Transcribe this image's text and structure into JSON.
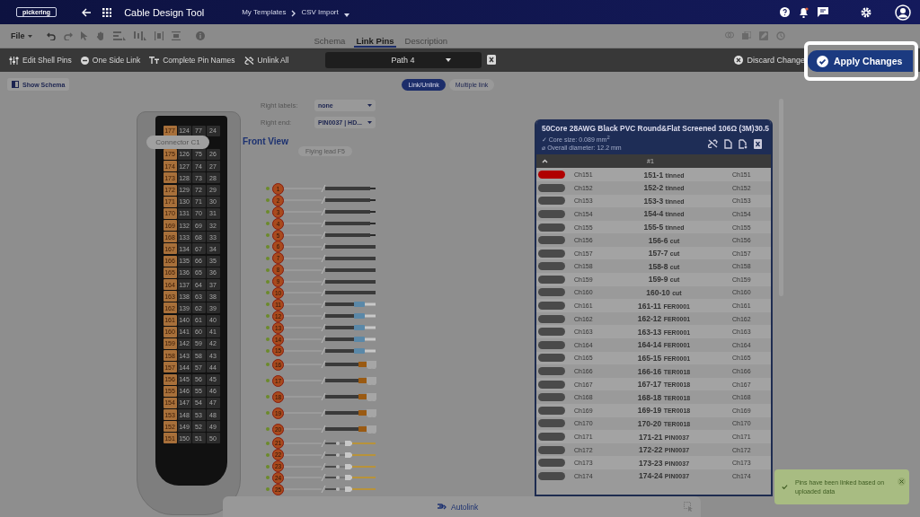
{
  "header": {
    "logo": "pickering",
    "app_title": "Cable Design Tool",
    "breadcrumb": [
      "My Templates",
      "CSV Import"
    ]
  },
  "menu": {
    "file": "File"
  },
  "view_tabs": [
    {
      "label": "Schema",
      "selected": false
    },
    {
      "label": "Link Pins",
      "selected": true
    },
    {
      "label": "Description",
      "selected": false
    }
  ],
  "actions": [
    {
      "label": "Edit Shell Pins",
      "kind": "shell"
    },
    {
      "label": "One Side Link",
      "kind": "one-side"
    },
    {
      "label": "Complete Pin Names",
      "kind": "text"
    },
    {
      "label": "Unlink All",
      "kind": "unlink"
    }
  ],
  "path_select": {
    "value": "Path 4"
  },
  "discard": "Discard Change",
  "apply": "Apply Changes",
  "show_schema": "Show Schema",
  "link_modes": [
    {
      "label": "Link/Unlink",
      "selected": true
    },
    {
      "label": "Multiple link",
      "selected": false
    }
  ],
  "selectors": [
    {
      "label": "Right labels:",
      "value": "none"
    },
    {
      "label": "Right end:",
      "value": "PIN0037 | HD..."
    }
  ],
  "connector": {
    "label": "Connector C1",
    "pin_rows": [
      [
        "177",
        "124",
        "77",
        "24"
      ],
      [
        "175",
        "126",
        "75",
        "26"
      ],
      [
        "174",
        "127",
        "74",
        "27"
      ],
      [
        "173",
        "128",
        "73",
        "28"
      ],
      [
        "172",
        "129",
        "72",
        "29"
      ],
      [
        "171",
        "130",
        "71",
        "30"
      ],
      [
        "170",
        "131",
        "70",
        "31"
      ],
      [
        "169",
        "132",
        "69",
        "32"
      ],
      [
        "168",
        "133",
        "68",
        "33"
      ],
      [
        "167",
        "134",
        "67",
        "34"
      ],
      [
        "166",
        "135",
        "66",
        "35"
      ],
      [
        "165",
        "136",
        "65",
        "36"
      ],
      [
        "164",
        "137",
        "64",
        "37"
      ],
      [
        "163",
        "138",
        "63",
        "38"
      ],
      [
        "162",
        "139",
        "62",
        "39"
      ],
      [
        "161",
        "140",
        "61",
        "40"
      ],
      [
        "160",
        "141",
        "60",
        "41"
      ],
      [
        "159",
        "142",
        "59",
        "42"
      ],
      [
        "158",
        "143",
        "58",
        "43"
      ],
      [
        "157",
        "144",
        "57",
        "44"
      ],
      [
        "156",
        "145",
        "56",
        "45"
      ],
      [
        "155",
        "146",
        "55",
        "46"
      ],
      [
        "154",
        "147",
        "54",
        "47"
      ],
      [
        "153",
        "148",
        "53",
        "48"
      ],
      [
        "152",
        "149",
        "52",
        "49"
      ],
      [
        "151",
        "150",
        "51",
        "50"
      ]
    ]
  },
  "flying_lead": {
    "view_title": "Front View",
    "label": "Flying lead F5",
    "wires": [
      {
        "number": "1",
        "kind": "bare"
      },
      {
        "number": "2",
        "kind": "bare"
      },
      {
        "number": "3",
        "kind": "bare"
      },
      {
        "number": "4",
        "kind": "bare"
      },
      {
        "number": "5",
        "kind": "bare"
      },
      {
        "number": "6",
        "kind": "cut"
      },
      {
        "number": "7",
        "kind": "cut"
      },
      {
        "number": "8",
        "kind": "cut"
      },
      {
        "number": "9",
        "kind": "cut"
      },
      {
        "number": "10",
        "kind": "cut"
      },
      {
        "number": "11",
        "kind": "ferrule"
      },
      {
        "number": "12",
        "kind": "ferrule"
      },
      {
        "number": "13",
        "kind": "ferrule"
      },
      {
        "number": "14",
        "kind": "ferrule"
      },
      {
        "number": "15",
        "kind": "ferrule"
      },
      {
        "number": "16",
        "kind": "terminal"
      },
      {
        "number": "17",
        "kind": "terminal"
      },
      {
        "number": "18",
        "kind": "terminal"
      },
      {
        "number": "19",
        "kind": "terminal"
      },
      {
        "number": "20",
        "kind": "terminal"
      },
      {
        "number": "21",
        "kind": "pin"
      },
      {
        "number": "22",
        "kind": "pin"
      },
      {
        "number": "23",
        "kind": "pin"
      },
      {
        "number": "24",
        "kind": "pin"
      },
      {
        "number": "25",
        "kind": "pin"
      }
    ]
  },
  "cable": {
    "title": "50Core 28AWG Black PVC Round&Flat Screened 106Ω (3M)30.5",
    "specs": [
      "✓ Core size: 0.089 mm$^{2}$",
      "⌀ Overall diameter: 12.2 mm"
    ],
    "column_header": "#1",
    "rows": [
      {
        "color": "#b00000",
        "left": "Ch151",
        "core": "151-1",
        "termination": "tinned",
        "right": "Ch151"
      },
      {
        "color": "#4a4a4a",
        "left": "Ch152",
        "core": "152-2",
        "termination": "tinned",
        "right": "Ch152"
      },
      {
        "color": "#4a4a4a",
        "left": "Ch153",
        "core": "153-3",
        "termination": "tinned",
        "right": "Ch153"
      },
      {
        "color": "#4a4a4a",
        "left": "Ch154",
        "core": "154-4",
        "termination": "tinned",
        "right": "Ch154"
      },
      {
        "color": "#4a4a4a",
        "left": "Ch155",
        "core": "155-5",
        "termination": "tinned",
        "right": "Ch155"
      },
      {
        "color": "#4a4a4a",
        "left": "Ch156",
        "core": "156-6",
        "termination": "cut",
        "right": "Ch156"
      },
      {
        "color": "#4a4a4a",
        "left": "Ch157",
        "core": "157-7",
        "termination": "cut",
        "right": "Ch157"
      },
      {
        "color": "#4a4a4a",
        "left": "Ch158",
        "core": "158-8",
        "termination": "cut",
        "right": "Ch158"
      },
      {
        "color": "#4a4a4a",
        "left": "Ch159",
        "core": "159-9",
        "termination": "cut",
        "right": "Ch159"
      },
      {
        "color": "#4a4a4a",
        "left": "Ch160",
        "core": "160-10",
        "termination": "cut",
        "right": "Ch160"
      },
      {
        "color": "#4a4a4a",
        "left": "Ch161",
        "core": "161-11",
        "termination": "FER0001",
        "right": "Ch161"
      },
      {
        "color": "#4a4a4a",
        "left": "Ch162",
        "core": "162-12",
        "termination": "FER0001",
        "right": "Ch162"
      },
      {
        "color": "#4a4a4a",
        "left": "Ch163",
        "core": "163-13",
        "termination": "FER0001",
        "right": "Ch163"
      },
      {
        "color": "#4a4a4a",
        "left": "Ch164",
        "core": "164-14",
        "termination": "FER0001",
        "right": "Ch164"
      },
      {
        "color": "#4a4a4a",
        "left": "Ch165",
        "core": "165-15",
        "termination": "FER0001",
        "right": "Ch165"
      },
      {
        "color": "#4a4a4a",
        "left": "Ch166",
        "core": "166-16",
        "termination": "TER0018",
        "right": "Ch166"
      },
      {
        "color": "#4a4a4a",
        "left": "Ch167",
        "core": "167-17",
        "termination": "TER0018",
        "right": "Ch167"
      },
      {
        "color": "#4a4a4a",
        "left": "Ch168",
        "core": "168-18",
        "termination": "TER0018",
        "right": "Ch168"
      },
      {
        "color": "#4a4a4a",
        "left": "Ch169",
        "core": "169-19",
        "termination": "TER0018",
        "right": "Ch169"
      },
      {
        "color": "#4a4a4a",
        "left": "Ch170",
        "core": "170-20",
        "termination": "TER0018",
        "right": "Ch170"
      },
      {
        "color": "#4a4a4a",
        "left": "Ch171",
        "core": "171-21",
        "termination": "PIN0037",
        "right": "Ch171"
      },
      {
        "color": "#4a4a4a",
        "left": "Ch172",
        "core": "172-22",
        "termination": "PIN0037",
        "right": "Ch172"
      },
      {
        "color": "#4a4a4a",
        "left": "Ch173",
        "core": "173-23",
        "termination": "PIN0037",
        "right": "Ch173"
      },
      {
        "color": "#4a4a4a",
        "left": "Ch174",
        "core": "174-24",
        "termination": "PIN0037",
        "right": "Ch174"
      }
    ]
  },
  "autolink": "Autolink",
  "toast": {
    "message": "Pins have been linked based on uploaded data"
  }
}
